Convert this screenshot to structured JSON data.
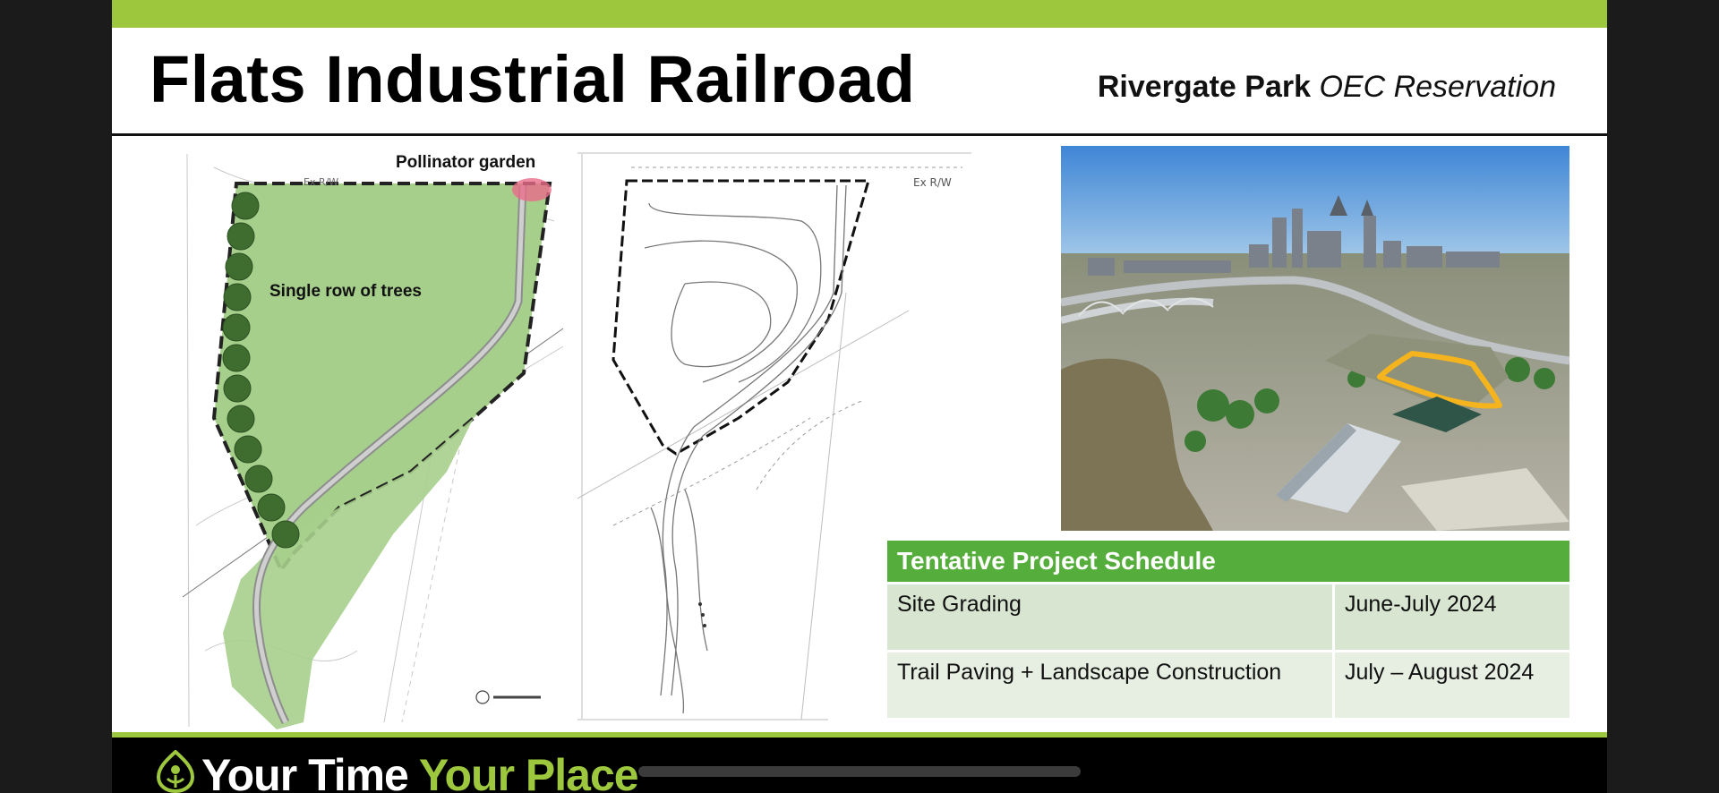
{
  "slide": {
    "title": "Flats Industrial Railroad",
    "subtitle_bold": "Rivergate Park",
    "subtitle_italic": "OEC Reservation"
  },
  "site_plan": {
    "label_pollinator": "Pollinator garden",
    "label_trees": "Single row of trees",
    "label_row": "Ex R/W"
  },
  "grading_plan": {
    "label_row": "Ex R/W"
  },
  "schedule": {
    "header": "Tentative Project Schedule",
    "rows": [
      {
        "task": "Site Grading",
        "dates": "June-July 2024"
      },
      {
        "task": "Trail Paving + Landscape Construction",
        "dates": "July – August 2024"
      }
    ]
  },
  "footer": {
    "brand_white": "Your Time ",
    "brand_green": "Your Place"
  },
  "colors": {
    "accent_green": "#9dc73d",
    "header_green": "#55ad3b",
    "plan_fill": "#a7cf8c",
    "site_outline": "#f5b41d"
  }
}
